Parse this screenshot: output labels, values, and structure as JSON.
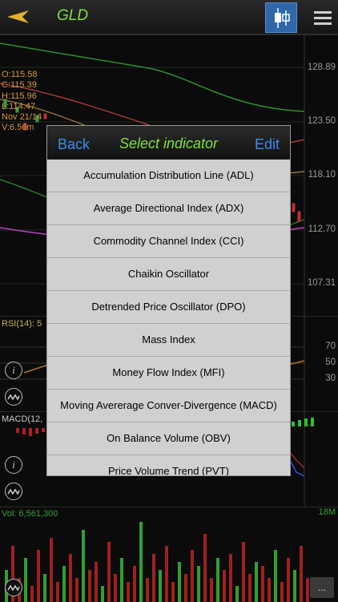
{
  "header": {
    "ticker": "GLD"
  },
  "price_pane": {
    "ohlc": [
      "O:115.58",
      "C:115.39",
      "H:115.96",
      "L:114.47",
      "Nov 21/14",
      "V:6.56m"
    ],
    "y_labels": [
      "128.89",
      "123.50",
      "118.10",
      "112.70",
      "107.31"
    ]
  },
  "rsi_pane": {
    "label": "RSI(14): 5",
    "y_labels": [
      "70",
      "50",
      "30"
    ]
  },
  "macd_pane": {
    "label": "MACD(12,"
  },
  "volume_pane": {
    "label": "Vol: 6,561,300",
    "max_label": "18M"
  },
  "more_button": "...",
  "modal": {
    "back_label": "Back",
    "title": "Select indicator",
    "edit_label": "Edit",
    "items": [
      "Accumulation Distribution Line (ADL)",
      "Average Directional Index (ADX)",
      "Commodity Channel Index (CCI)",
      "Chaikin Oscillator",
      "Detrended Price Oscillator (DPO)",
      "Mass Index",
      "Money Flow Index (MFI)",
      "Moving Avererage Conver-Divergence (MACD)",
      "On Balance Volume (OBV)",
      "Price Volume Trend (PVT)"
    ]
  },
  "colors": {
    "accent_green": "#7de03a",
    "link_blue": "#3a8ff0",
    "ohlc_text": "#d99a3a"
  }
}
